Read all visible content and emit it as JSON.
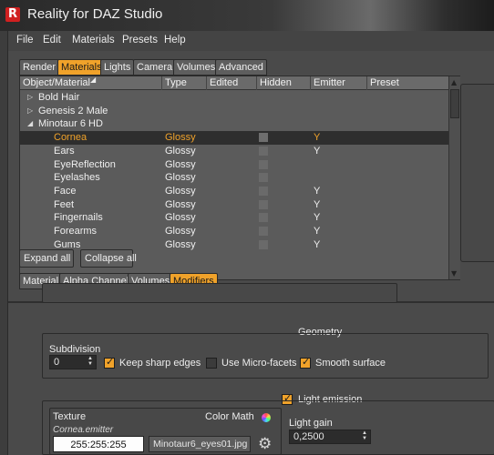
{
  "app": {
    "title": "Reality for DAZ Studio",
    "icon": "reality-icon"
  },
  "menu": [
    "File",
    "Edit",
    "Materials",
    "Presets",
    "Help"
  ],
  "main_tabs": [
    "Render",
    "Materials",
    "Lights",
    "Camera",
    "Volumes",
    "Advanced"
  ],
  "main_tab_active": "Materials",
  "table": {
    "columns": [
      "Object/Material",
      "Type",
      "Edited",
      "Hidden",
      "Emitter",
      "Preset"
    ],
    "groups": [
      {
        "name": "Bold Hair",
        "expanded": false
      },
      {
        "name": "Genesis 2 Male",
        "expanded": false
      },
      {
        "name": "Minotaur 6 HD",
        "expanded": true
      }
    ],
    "rows": [
      {
        "name": "Cornea",
        "type": "Glossy",
        "emitter": "Y",
        "selected": true
      },
      {
        "name": "Ears",
        "type": "Glossy",
        "emitter": "Y",
        "selected": false
      },
      {
        "name": "EyeReflection",
        "type": "Glossy",
        "emitter": "",
        "selected": false
      },
      {
        "name": "Eyelashes",
        "type": "Glossy",
        "emitter": "",
        "selected": false
      },
      {
        "name": "Face",
        "type": "Glossy",
        "emitter": "Y",
        "selected": false
      },
      {
        "name": "Feet",
        "type": "Glossy",
        "emitter": "Y",
        "selected": false
      },
      {
        "name": "Fingernails",
        "type": "Glossy",
        "emitter": "Y",
        "selected": false
      },
      {
        "name": "Forearms",
        "type": "Glossy",
        "emitter": "Y",
        "selected": false
      },
      {
        "name": "Gums",
        "type": "Glossy",
        "emitter": "Y",
        "selected": false
      }
    ]
  },
  "buttons": {
    "expand_all": "Expand all",
    "collapse_all": "Collapse all"
  },
  "sub_tabs": [
    "Material",
    "Alpha Channel",
    "Volumes",
    "Modifiers"
  ],
  "sub_tab_active": "Modifiers",
  "geometry": {
    "title": "Geometry",
    "subdivision_label": "Subdivision",
    "subdivision_value": "0",
    "keep_sharp_edges": {
      "label": "Keep sharp edges",
      "checked": true
    },
    "use_micro_facets": {
      "label": "Use Micro-facets",
      "checked": false
    },
    "smooth_surface": {
      "label": "Smooth surface",
      "checked": true
    }
  },
  "light_emission": {
    "label": "Light emission",
    "checked": true,
    "texture_label": "Texture",
    "color_math_label": "Color Math",
    "texture_name": "Cornea.emitter",
    "color_value": "255:255:255",
    "image_file": "Minotaur6_eyes01.jpg",
    "light_gain_label": "Light gain",
    "light_gain_value": "0,2500"
  },
  "colors": {
    "accent": "#f0a22a",
    "panel": "#5b5b5b",
    "selected_row": "#2e2e2e"
  }
}
